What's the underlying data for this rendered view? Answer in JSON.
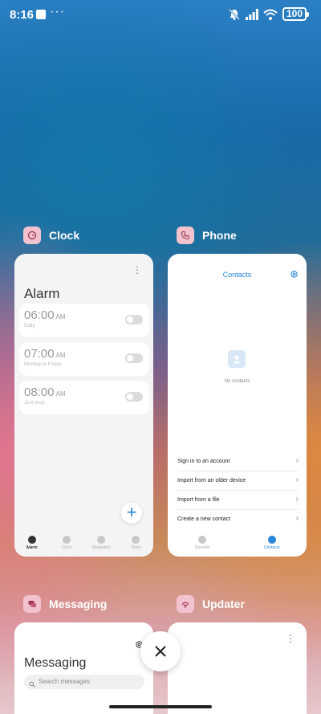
{
  "status_bar": {
    "time": "8:16",
    "dots": "···",
    "battery": "100"
  },
  "apps": {
    "clock": {
      "name": "Clock",
      "title": "Alarm",
      "alarms": [
        {
          "time": "06:00",
          "period": "AM",
          "label": "Daily"
        },
        {
          "time": "07:00",
          "period": "AM",
          "label": "Monday to Friday"
        },
        {
          "time": "08:00",
          "period": "AM",
          "label": "Just once"
        }
      ],
      "fab": "+",
      "nav": [
        "Alarm",
        "Clock",
        "Stopwatch",
        "Timer"
      ]
    },
    "phone": {
      "name": "Phone",
      "title": "Contacts",
      "empty_text": "No contacts",
      "options": [
        "Sign in to an account",
        "Import from an older device",
        "Import from a file",
        "Create a new contact"
      ],
      "nav": [
        "Recents",
        "Contacts"
      ]
    },
    "messaging": {
      "name": "Messaging",
      "title": "Messaging",
      "search_placeholder": "Search messages"
    },
    "updater": {
      "name": "Updater"
    }
  },
  "colors": {
    "accent": "#2a86d9",
    "icon_bg": "#f2c2cf"
  }
}
